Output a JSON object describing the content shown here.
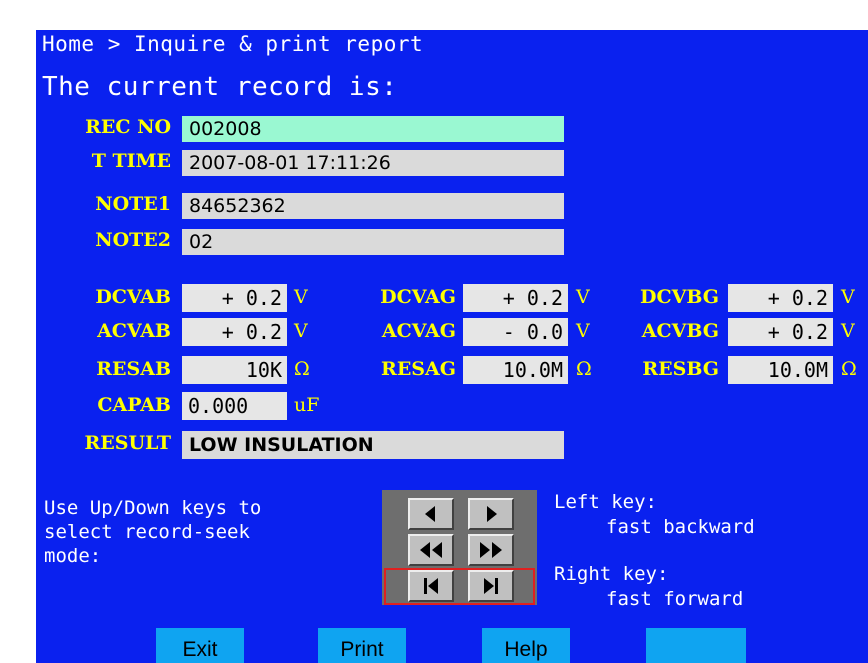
{
  "breadcrumb": "Home > Inquire & print report",
  "current_title": "The current record is:",
  "record": [
    {
      "label": "REC NO",
      "value": "002008",
      "active": true
    },
    {
      "label": "T TIME",
      "value": "2007-08-01 17:11:26",
      "active": false
    },
    {
      "label": "NOTE1",
      "value": "84652362",
      "active": false
    },
    {
      "label": "NOTE2",
      "value": "02",
      "active": false
    }
  ],
  "measurements": {
    "row1": [
      {
        "label": "DCVAB",
        "value": "+ 0.2",
        "unit": "V"
      },
      {
        "label": "DCVAG",
        "value": "+ 0.2",
        "unit": "V"
      },
      {
        "label": "DCVBG",
        "value": "+ 0.2",
        "unit": "V"
      }
    ],
    "row2": [
      {
        "label": "ACVAB",
        "value": "+ 0.2",
        "unit": "V"
      },
      {
        "label": "ACVAG",
        "value": "- 0.0",
        "unit": "V"
      },
      {
        "label": "ACVBG",
        "value": "+ 0.2",
        "unit": "V"
      }
    ],
    "row3": [
      {
        "label": "RESAB",
        "value": "10K",
        "unit": "Ω"
      },
      {
        "label": "RESAG",
        "value": "10.0M",
        "unit": "Ω"
      },
      {
        "label": "RESBG",
        "value": "10.0M",
        "unit": "Ω"
      }
    ],
    "capab": {
      "label": "CAPAB",
      "value": "0.000",
      "unit": "uF"
    }
  },
  "result": {
    "label": "RESULT",
    "value": "LOW INSULATION"
  },
  "hint_left": "Use Up/Down keys to\nselect record-seek\nmode:",
  "left_key": {
    "title": "Left key:",
    "desc": "fast backward"
  },
  "right_key": {
    "title": "Right key:",
    "desc": "fast forward"
  },
  "keypad": {
    "icons": [
      "step-back-icon",
      "step-forward-icon",
      "rewind-icon",
      "fast-forward-icon",
      "skip-first-icon",
      "skip-last-icon"
    ],
    "selected_row": 3
  },
  "buttons": {
    "exit": "Exit",
    "print": "Print",
    "help": "Help",
    "blank": ""
  },
  "colors": {
    "screen_bg": "#0a21ef",
    "text_primary": "#ffffff",
    "label": "#ffff00",
    "field_bg": "#dadada",
    "active_field_bg": "#9af8d2",
    "button_bg": "#0fa4f1",
    "selection_border": "#e02020"
  }
}
